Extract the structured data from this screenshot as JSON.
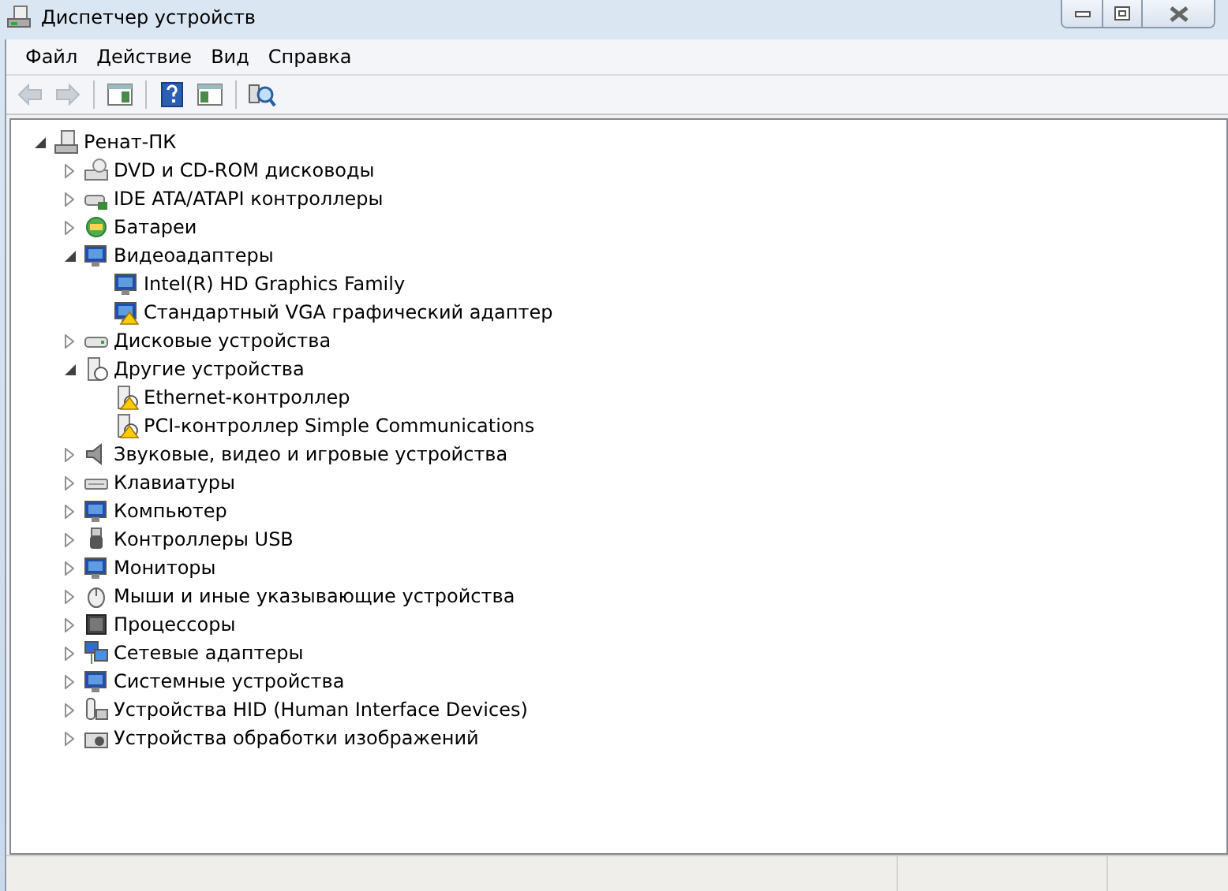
{
  "window": {
    "title": "Диспетчер устройств"
  },
  "menu": [
    {
      "label": "Файл"
    },
    {
      "label": "Действие"
    },
    {
      "label": "Вид"
    },
    {
      "label": "Справка"
    }
  ],
  "toolbar": [
    {
      "kind": "back",
      "disabled": true
    },
    {
      "kind": "forward",
      "disabled": true
    },
    {
      "kind": "sep"
    },
    {
      "kind": "console",
      "disabled": false
    },
    {
      "kind": "sep"
    },
    {
      "kind": "help",
      "disabled": false
    },
    {
      "kind": "panel",
      "disabled": false
    },
    {
      "kind": "sep"
    },
    {
      "kind": "scan",
      "disabled": false
    }
  ],
  "tree": [
    {
      "label": "Ренат-ПК",
      "kind": "computer",
      "expanded": true,
      "children": [
        {
          "label": "DVD и CD-ROM дисководы",
          "kind": "disc",
          "expanded": false
        },
        {
          "label": "IDE ATA/ATAPI контроллеры",
          "kind": "controller",
          "expanded": false
        },
        {
          "label": "Батареи",
          "kind": "battery",
          "expanded": false
        },
        {
          "label": "Видеоадаптеры",
          "kind": "monitor",
          "expanded": true,
          "children": [
            {
              "label": "Intel(R) HD Graphics Family",
              "kind": "monitor",
              "warning": false
            },
            {
              "label": "Стандартный VGA графический адаптер",
              "kind": "monitor",
              "warning": true
            }
          ]
        },
        {
          "label": "Дисковые устройства",
          "kind": "drive",
          "expanded": false
        },
        {
          "label": "Другие устройства",
          "kind": "unknown",
          "expanded": true,
          "children": [
            {
              "label": "Ethernet-контроллер",
              "kind": "unknown",
              "warning": true
            },
            {
              "label": "PCI-контроллер Simple Communications",
              "kind": "unknown",
              "warning": true
            }
          ]
        },
        {
          "label": "Звуковые, видео и игровые устройства",
          "kind": "speaker",
          "expanded": false
        },
        {
          "label": "Клавиатуры",
          "kind": "keyboard",
          "expanded": false
        },
        {
          "label": "Компьютер",
          "kind": "monitor",
          "expanded": false
        },
        {
          "label": "Контроллеры USB",
          "kind": "usb",
          "expanded": false
        },
        {
          "label": "Мониторы",
          "kind": "monitor",
          "expanded": false
        },
        {
          "label": "Мыши и иные указывающие устройства",
          "kind": "mouse",
          "expanded": false
        },
        {
          "label": "Процессоры",
          "kind": "chip",
          "expanded": false
        },
        {
          "label": "Сетевые адаптеры",
          "kind": "network",
          "expanded": false
        },
        {
          "label": "Системные устройства",
          "kind": "monitor",
          "expanded": false
        },
        {
          "label": "Устройства HID (Human Interface Devices)",
          "kind": "hid",
          "expanded": false
        },
        {
          "label": "Устройства обработки изображений",
          "kind": "camera",
          "expanded": false
        }
      ]
    }
  ]
}
